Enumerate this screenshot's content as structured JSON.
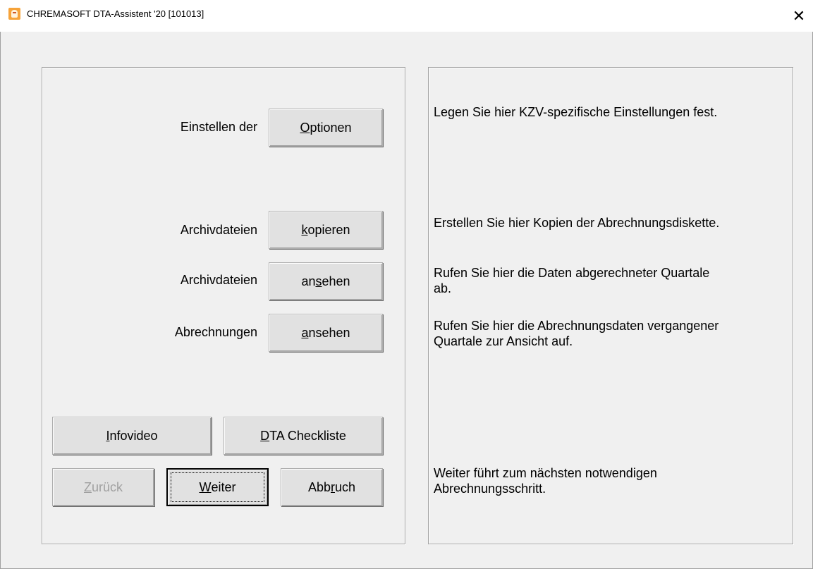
{
  "window": {
    "title": "CHREMASOFT DTA-Assistent '20 [101013]",
    "close_symbol": "✕"
  },
  "rows": [
    {
      "label": "Einstellen der",
      "button": {
        "before": "",
        "mnemonic": "O",
        "after": "ptionen"
      },
      "description": "Legen Sie hier KZV-spezifische Einstellungen fest."
    },
    {
      "label": "Archivdateien",
      "button": {
        "before": "",
        "mnemonic": "k",
        "after": "opieren"
      },
      "description": "Erstellen Sie hier Kopien der Abrechnungsdiskette."
    },
    {
      "label": "Archivdateien",
      "button": {
        "before": "an",
        "mnemonic": "s",
        "after": "ehen"
      },
      "description_line1": "Rufen Sie hier die Daten abgerechneter Quartale",
      "description_line2": "ab."
    },
    {
      "label": "Abrechnungen",
      "button": {
        "before": "",
        "mnemonic": "a",
        "after": "nsehen"
      },
      "description_line1": "Rufen Sie hier die Abrechnungsdaten vergangener",
      "description_line2": "Quartale zur Ansicht auf."
    }
  ],
  "bottom_buttons": {
    "infovideo": {
      "before": "",
      "mnemonic": "I",
      "after": "nfovideo"
    },
    "checkliste": {
      "before": "",
      "mnemonic": "D",
      "after": "TA Checkliste"
    },
    "zurueck": {
      "before": "",
      "mnemonic": "Z",
      "after": "urück"
    },
    "weiter": {
      "before": "",
      "mnemonic": "W",
      "after": "eiter"
    },
    "abbruch": {
      "before": "Abb",
      "mnemonic": "r",
      "after": "uch"
    }
  },
  "weiter_description_line1": "Weiter führt zum nächsten notwendigen",
  "weiter_description_line2": "Abrechnungsschritt."
}
